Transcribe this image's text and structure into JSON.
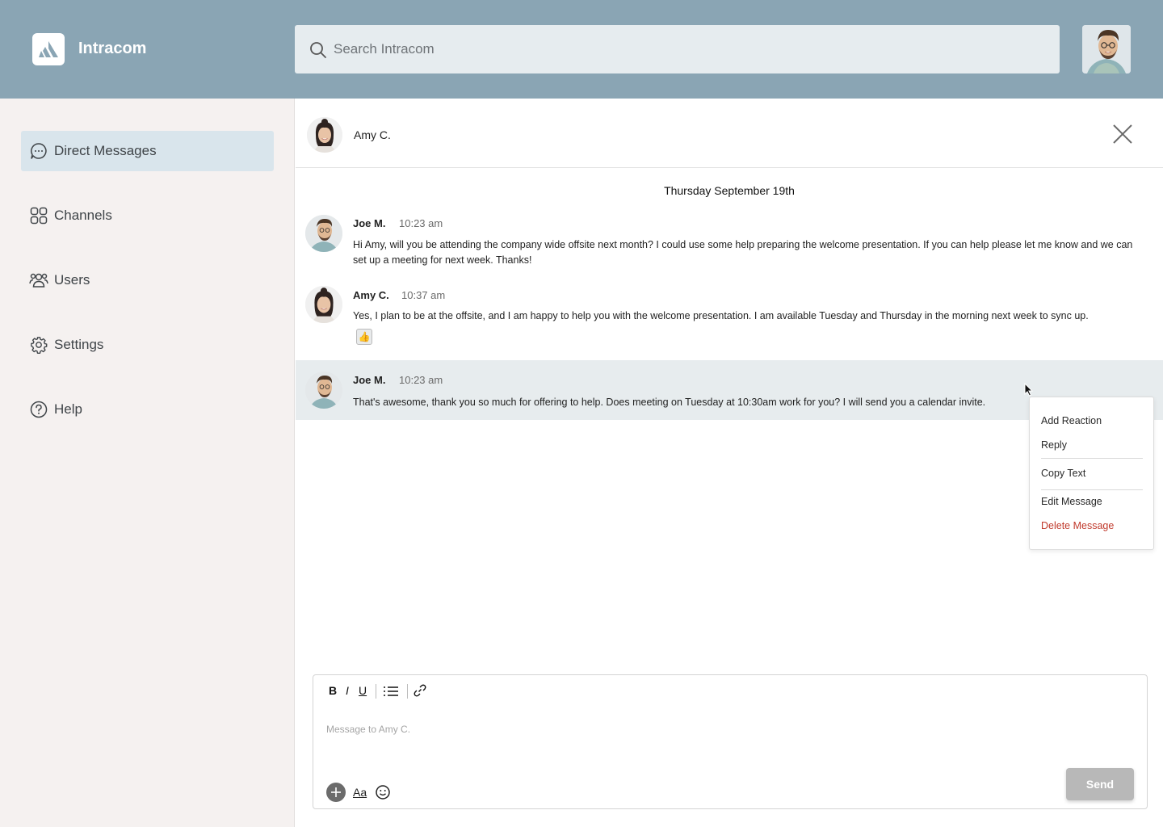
{
  "app": {
    "name": "Intracom",
    "logo_icon": "intracom-logo-icon"
  },
  "search": {
    "placeholder": "Search Intracom",
    "value": ""
  },
  "current_user": {
    "avatar": "user-avatar"
  },
  "sidebar": {
    "items": [
      {
        "label": "Direct Messages",
        "icon": "chat-bubble-icon",
        "active": true
      },
      {
        "label": "Channels",
        "icon": "grid-icon",
        "active": false
      },
      {
        "label": "Users",
        "icon": "users-icon",
        "active": false
      },
      {
        "label": "Settings",
        "icon": "gear-icon",
        "active": false
      },
      {
        "label": "Help",
        "icon": "help-icon",
        "active": false
      }
    ]
  },
  "conversation": {
    "recipient": "Amy C.",
    "date_divider": "Thursday September 19th",
    "messages": [
      {
        "author": "Joe M.",
        "time": "10:23 am",
        "text": "Hi Amy, will you be attending the company wide offsite next month? I could use some help preparing the welcome presentation. If you can help please let me know and we can set up a meeting for next week. Thanks!"
      },
      {
        "author": "Amy C.",
        "time": "10:37 am",
        "text": "Yes, I plan to be at the offsite, and I am happy to help you with the welcome presentation. I am available Tuesday and Thursday in the morning next week to sync up.",
        "reaction": "👍"
      },
      {
        "author": "Joe M.",
        "time": "10:23 am",
        "text": "That's awesome, thank you so much for offering to help. Does meeting on Tuesday at 10:30am work for you? I will send you a calendar invite."
      }
    ]
  },
  "context_menu": {
    "items": [
      "Add Reaction",
      "Reply",
      "Copy Text",
      "Edit Message",
      "Delete Message"
    ]
  },
  "composer": {
    "bold": "B",
    "italic": "I",
    "underline": "U",
    "placeholder": "Message to Amy C.",
    "value": "",
    "text_format": "Aa",
    "send_label": "Send"
  },
  "colors": {
    "header": "#8aa5b4",
    "sidebar": "#f5f1f0",
    "active_nav": "#d9e5ec",
    "highlight_row": "#e7ecee",
    "danger": "#c0392b",
    "send_disabled": "#b8b8b8"
  }
}
